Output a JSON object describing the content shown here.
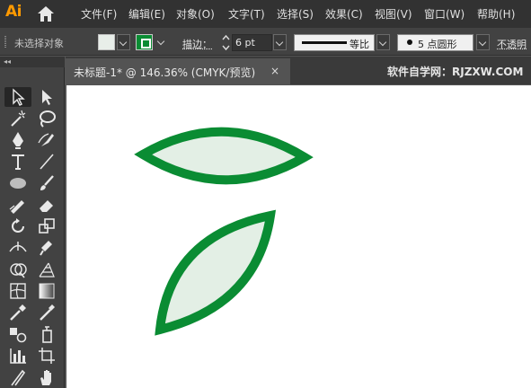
{
  "app": {
    "logo": "Ai"
  },
  "menu": [
    {
      "label": "文件(F)"
    },
    {
      "label": "编辑(E)"
    },
    {
      "label": "对象(O)"
    },
    {
      "label": "文字(T)"
    },
    {
      "label": "选择(S)"
    },
    {
      "label": "效果(C)"
    },
    {
      "label": "视图(V)"
    },
    {
      "label": "窗口(W)"
    },
    {
      "label": "帮助(H)"
    }
  ],
  "control_bar": {
    "selection_status": "未选择对象",
    "stroke_label": "描边：",
    "stroke_weight": "6 pt",
    "profile_label": "等比",
    "brush_label": "5 点圆形",
    "opacity_label": "不透明"
  },
  "document_tab": {
    "title": "未标题-1* @ 146.36% (CMYK/预览)",
    "close_glyph": "×"
  },
  "watermark": "软件自学网：RJZXW.COM",
  "colors": {
    "fill": "#e3efe5",
    "stroke": "#0a8c33",
    "logo": "#ff9a00",
    "ui_dark": "#323232",
    "ui_panel": "#424242",
    "canvas": "#ffffff"
  },
  "tools": [
    "selection-tool-icon",
    "direct-selection-tool-icon",
    "magic-wand-tool-icon",
    "lasso-tool-icon",
    "pen-tool-icon",
    "curvature-tool-icon",
    "type-tool-icon",
    "line-segment-tool-icon",
    "ellipse-tool-icon",
    "paintbrush-tool-icon",
    "shaper-tool-icon",
    "eraser-tool-icon",
    "rotate-tool-icon",
    "scale-tool-icon",
    "width-tool-icon",
    "puppet-warp-tool-icon",
    "shape-builder-tool-icon",
    "perspective-grid-tool-icon",
    "mesh-tool-icon",
    "gradient-tool-icon",
    "eyedropper-tool-icon",
    "measure-tool-icon",
    "blend-tool-icon",
    "symbol-sprayer-tool-icon",
    "column-graph-tool-icon",
    "artboard-tool-icon",
    "slice-tool-icon",
    "hand-tool-icon"
  ]
}
